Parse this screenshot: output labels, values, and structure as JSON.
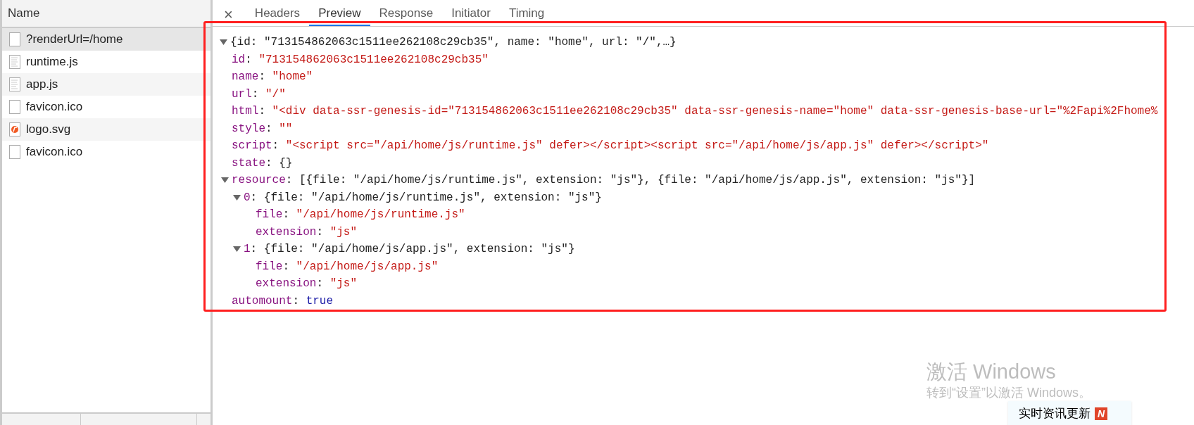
{
  "requests": {
    "header": "Name",
    "items": [
      {
        "name": "?renderUrl=/home",
        "kind": "document",
        "selected": true
      },
      {
        "name": "runtime.js",
        "kind": "script",
        "selected": false
      },
      {
        "name": "app.js",
        "kind": "script",
        "selected": false
      },
      {
        "name": "favicon.ico",
        "kind": "document",
        "selected": false
      },
      {
        "name": "logo.svg",
        "kind": "image",
        "selected": false
      },
      {
        "name": "favicon.ico",
        "kind": "document",
        "selected": false
      }
    ]
  },
  "close_glyph": "×",
  "tabs": [
    {
      "label": "Headers",
      "selected": false
    },
    {
      "label": "Preview",
      "selected": true
    },
    {
      "label": "Response",
      "selected": false
    },
    {
      "label": "Initiator",
      "selected": false
    },
    {
      "label": "Timing",
      "selected": false
    }
  ],
  "preview": {
    "separator": ":",
    "summary": "{id: \"713154862063c1511ee262108c29cb35\", name: \"home\", url: \"/\",…}",
    "expanded": true,
    "children": [
      {
        "key": "id",
        "value": "\"713154862063c1511ee262108c29cb35\"",
        "kind": "string"
      },
      {
        "key": "name",
        "value": "\"home\"",
        "kind": "string"
      },
      {
        "key": "url",
        "value": "\"/\"",
        "kind": "string"
      },
      {
        "key": "html",
        "value": "\"<div data-ssr-genesis-id=\"713154862063c1511ee262108c29cb35\" data-ssr-genesis-name=\"home\" data-ssr-genesis-base-url=\"%2Fapi%2Fhome%",
        "kind": "string"
      },
      {
        "key": "style",
        "value": "\"\"",
        "kind": "string"
      },
      {
        "key": "script",
        "value": "\"<script src=\"/api/home/js/runtime.js\" defer></script><script src=\"/api/home/js/app.js\" defer></script>\"",
        "kind": "string"
      },
      {
        "key": "state",
        "value": "{}",
        "kind": "object"
      },
      {
        "key": "resource",
        "value": "[{file: \"/api/home/js/runtime.js\", extension: \"js\"}, {file: \"/api/home/js/app.js\", extension: \"js\"}]",
        "kind": "object",
        "expanded": true,
        "children": [
          {
            "key": "0",
            "value": "{file: \"/api/home/js/runtime.js\", extension: \"js\"}",
            "kind": "object",
            "expanded": true,
            "children": [
              {
                "key": "file",
                "value": "\"/api/home/js/runtime.js\"",
                "kind": "string"
              },
              {
                "key": "extension",
                "value": "\"js\"",
                "kind": "string"
              }
            ]
          },
          {
            "key": "1",
            "value": "{file: \"/api/home/js/app.js\", extension: \"js\"}",
            "kind": "object",
            "expanded": true,
            "children": [
              {
                "key": "file",
                "value": "\"/api/home/js/app.js\"",
                "kind": "string"
              },
              {
                "key": "extension",
                "value": "\"js\"",
                "kind": "string"
              }
            ]
          }
        ]
      },
      {
        "key": "automount",
        "value": "true",
        "kind": "boolean"
      }
    ]
  },
  "activation": {
    "title": "激活 Windows",
    "subtitle": "转到“设置”以激活 Windows。"
  },
  "news_popup": {
    "label": "实时资讯更新",
    "badge": "N"
  }
}
